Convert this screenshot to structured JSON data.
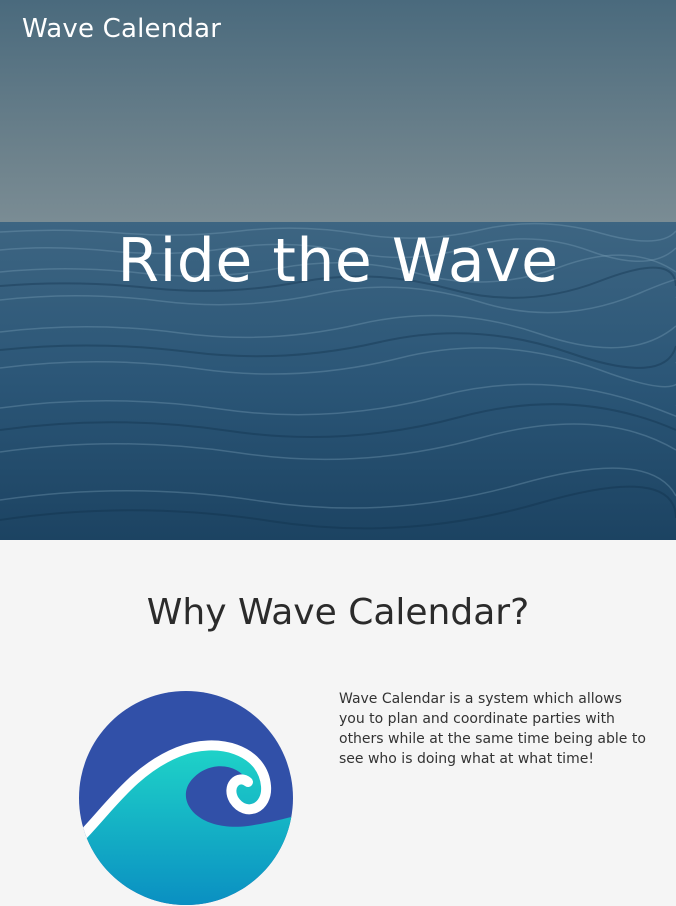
{
  "header": {
    "brand": "Wave Calendar"
  },
  "hero": {
    "title": "Ride the Wave"
  },
  "about": {
    "title": "Why Wave Calendar?",
    "description": "Wave Calendar is a system which allows you to plan and coordinate parties with others while at the same time being able to see who is doing what at what time!",
    "logo_icon": "wave-logo-icon"
  },
  "colors": {
    "logo_blue": "#3150a8",
    "logo_teal_top": "#1fd4c8",
    "logo_teal_bottom": "#0a8fc2",
    "page_background": "#f5f5f5",
    "sea_dark": "#1f4564"
  }
}
